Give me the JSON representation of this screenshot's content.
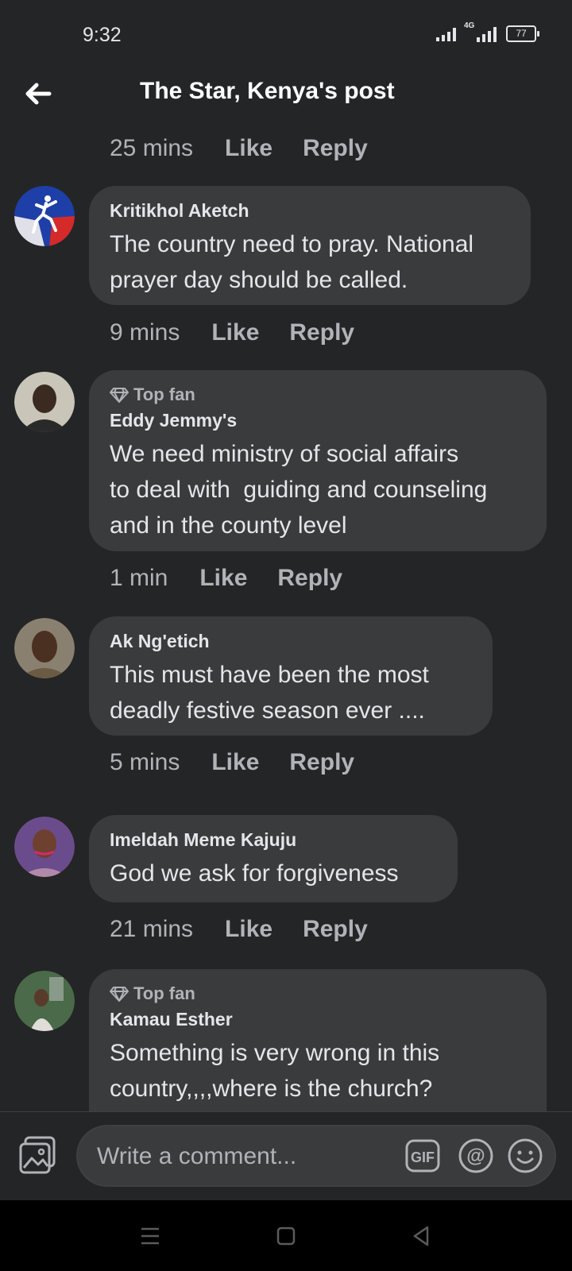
{
  "status_bar": {
    "time": "9:32",
    "network": "4G",
    "battery": "77"
  },
  "header": {
    "title": "The Star, Kenya's post"
  },
  "first_meta": {
    "time": "25 mins",
    "like": "Like",
    "reply": "Reply"
  },
  "comments": [
    {
      "top_fan": "",
      "author": "Kritikhol Aketch",
      "text": "The country need to pray. National\nprayer day should be called.",
      "time": "9 mins",
      "like": "Like",
      "reply": "Reply"
    },
    {
      "top_fan": "Top fan",
      "author": "Eddy Jemmy's",
      "text": "We need ministry of social affairs\nto deal with  guiding and counseling\nand in the county level",
      "time": "1 min",
      "like": "Like",
      "reply": "Reply"
    },
    {
      "top_fan": "",
      "author": "Ak Ng'etich",
      "text": "This must have been the most\ndeadly festive season ever ....",
      "time": "5 mins",
      "like": "Like",
      "reply": "Reply"
    },
    {
      "top_fan": "",
      "author": "Imeldah Meme Kajuju",
      "text": "God we ask for forgiveness",
      "time": "21 mins",
      "like": "Like",
      "reply": "Reply"
    },
    {
      "top_fan": "Top fan",
      "author": "Kamau Esther",
      "text": "Something is very wrong in this\ncountry,,,,where is the church?"
    }
  ],
  "composer": {
    "placeholder": "Write a comment..."
  },
  "colors": {
    "background": "#242526",
    "bubble": "#3a3b3c",
    "secondary_text": "#b0b3b8",
    "primary_text": "#e4e6eb"
  }
}
